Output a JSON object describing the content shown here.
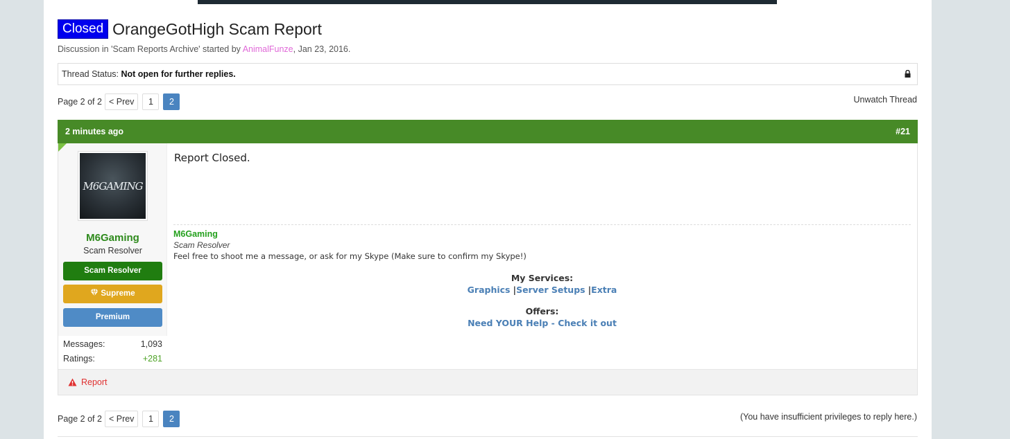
{
  "thread": {
    "prefix": "Closed",
    "title": "OrangeGotHigh Scam Report",
    "meta_before": "Discussion in 'Scam Reports Archive' started by ",
    "author": "AnimalFunze",
    "meta_after": ", Jan 23, 2016.",
    "status_label": "Thread Status:",
    "status_value": "Not open for further replies."
  },
  "pagination": {
    "label": "Page 2 of 2",
    "prev": "< Prev",
    "pages": [
      "1",
      "2"
    ],
    "current": "2"
  },
  "unwatch": "Unwatch Thread",
  "no_reply": "(You have insufficient privileges to reply here.)",
  "post": {
    "time": "2 minutes ago",
    "number": "#21",
    "avatar_text": "M6GAMING",
    "username": "M6Gaming",
    "user_title": "Scam Resolver",
    "banners": [
      "Scam Resolver",
      "Supreme",
      "Premium"
    ],
    "stats": [
      {
        "label": "Messages:",
        "value": "1,093"
      },
      {
        "label": "Ratings:",
        "value": "+281"
      }
    ],
    "message": "Report Closed.",
    "signature": {
      "name": "M6Gaming",
      "role": "Scam Resolver",
      "desc": "Feel free to shoot me a message, or ask for my Skype (Make sure to confirm my Skype!)",
      "services_heading": "My Services:",
      "services": [
        "Graphics",
        "Server Setups",
        "Extra"
      ],
      "offers_heading": "Offers:",
      "offers_link": "Need YOUR Help - Check it out"
    },
    "report": "Report"
  },
  "colors": {
    "prefix_bg": "#0000ee",
    "header_green": "#478a27",
    "username_green": "#2e8a1c",
    "page_current": "#4a84c0",
    "banner_green": "#207d10",
    "banner_gold": "#e0a71e",
    "banner_blue": "#4f8bc6",
    "report_red": "#e03030"
  }
}
